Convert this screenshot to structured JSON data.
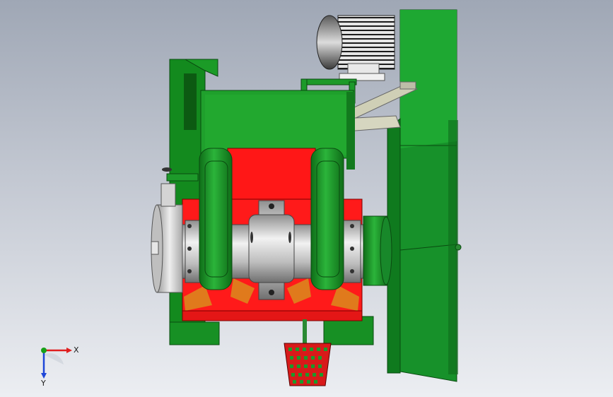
{
  "view": {
    "background_top": "#9fa7b5",
    "background_bottom": "#eceef2"
  },
  "colors": {
    "frame_green": "#1f9a2a",
    "frame_green_dark": "#0c5e14",
    "housing_red": "#ff1a1a",
    "liner_orange": "#e07a1c",
    "shaft_gray": "#c8c8c8",
    "motor_dark": "#2e2e2e",
    "hopper_red": "#d81a1a"
  },
  "triad": {
    "x_label": "X",
    "y_label": "Y",
    "x_color": "#e01e1e",
    "y_color": "#1e46d8",
    "origin_color": "#18a018"
  }
}
